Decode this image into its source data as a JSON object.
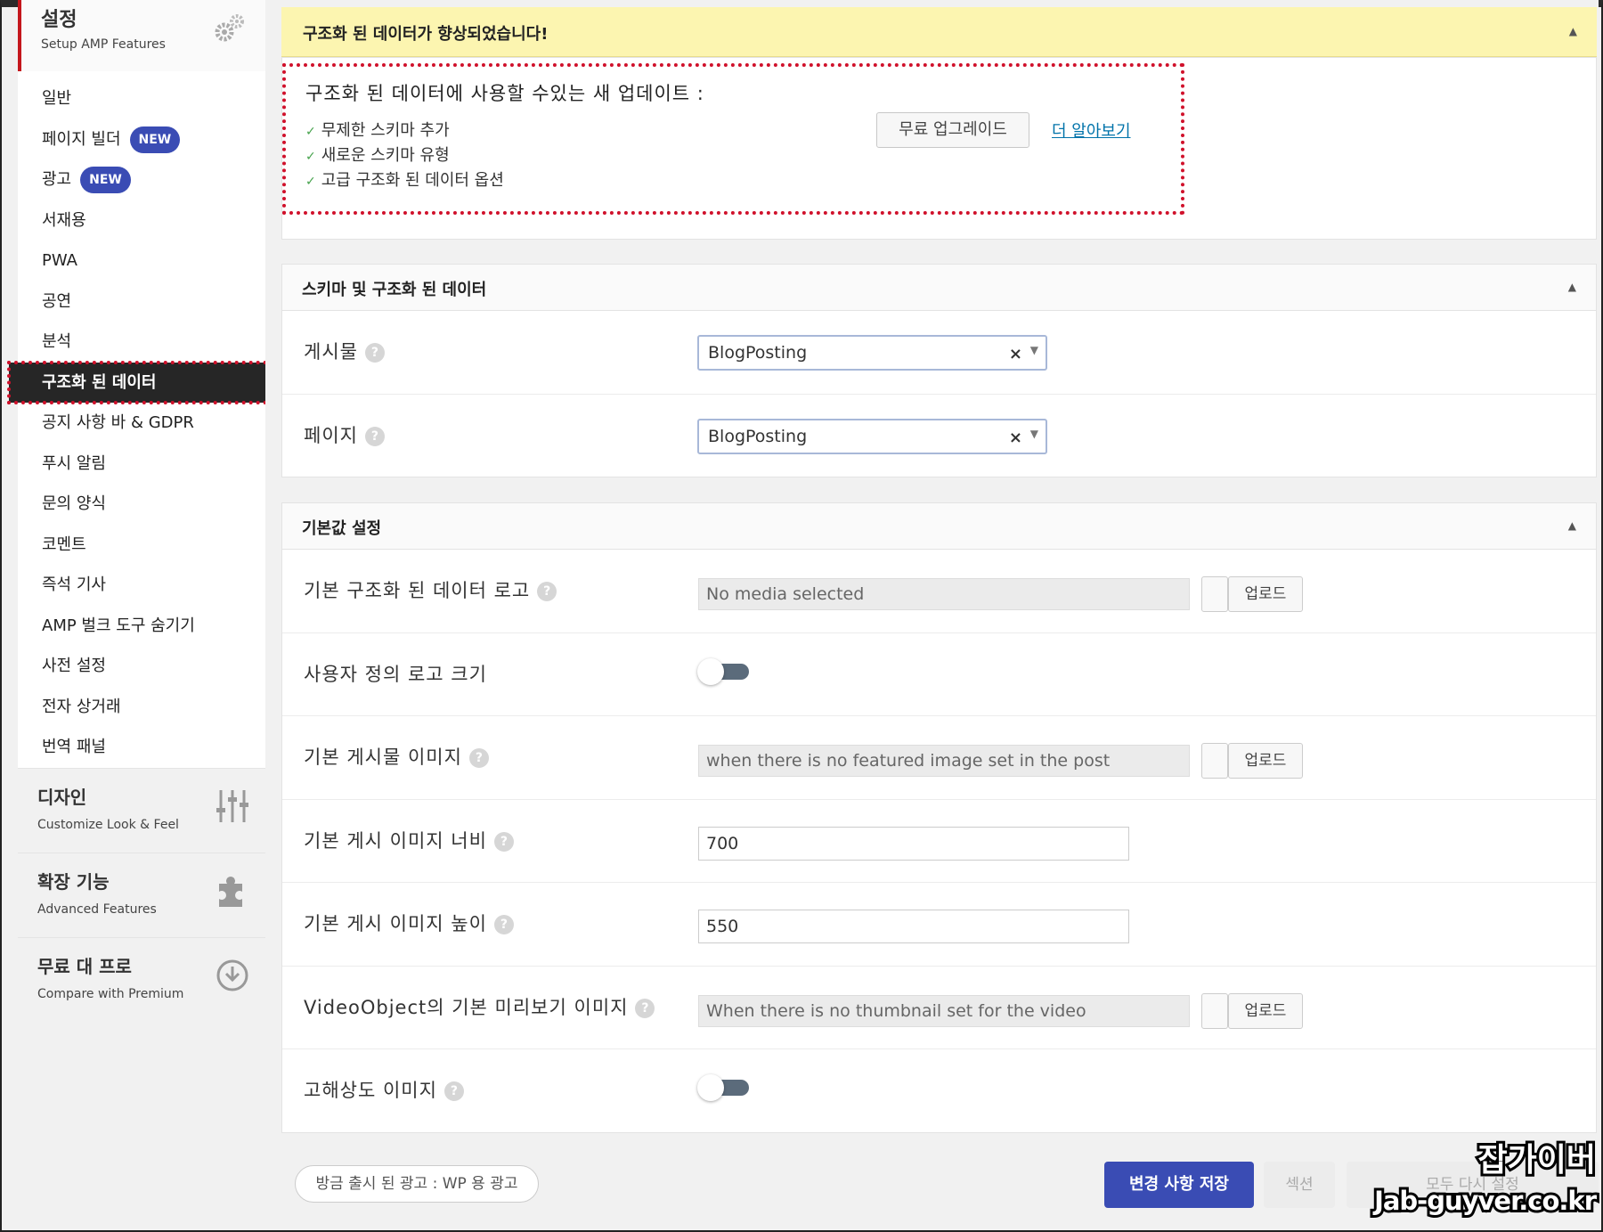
{
  "sidebar": {
    "header": {
      "title": "설정",
      "subtitle": "Setup AMP Features",
      "icon": "gears-icon"
    },
    "items": [
      {
        "label": "일반",
        "badge": ""
      },
      {
        "label": "페이지 빌더",
        "badge": "NEW"
      },
      {
        "label": "광고",
        "badge": "NEW"
      },
      {
        "label": "서재용",
        "badge": ""
      },
      {
        "label": "PWA",
        "badge": ""
      },
      {
        "label": "공연",
        "badge": ""
      },
      {
        "label": "분석",
        "badge": ""
      },
      {
        "label": "구조화 된 데이터",
        "badge": "",
        "active": true
      },
      {
        "label": "공지 사항 바 & GDPR",
        "badge": ""
      },
      {
        "label": "푸시 알림",
        "badge": ""
      },
      {
        "label": "문의 양식",
        "badge": ""
      },
      {
        "label": "코멘트",
        "badge": ""
      },
      {
        "label": "즉석 기사",
        "badge": ""
      },
      {
        "label": "AMP 벌크 도구 숨기기",
        "badge": ""
      },
      {
        "label": "사전 설정",
        "badge": ""
      },
      {
        "label": "전자 상거래",
        "badge": ""
      },
      {
        "label": "번역 패널",
        "badge": ""
      }
    ],
    "groups": [
      {
        "title": "디자인",
        "subtitle": "Customize Look & Feel",
        "icon": "sliders-icon"
      },
      {
        "title": "확장 기능",
        "subtitle": "Advanced Features",
        "icon": "puzzle-icon"
      },
      {
        "title": "무료 대 프로",
        "subtitle": "Compare with Premium",
        "icon": "download-circle-icon"
      }
    ]
  },
  "notice": {
    "text": "구조화 된 데이터가 향상되었습니다!"
  },
  "upgrade": {
    "heading": "구조화 된 데이터에 사용할 수있는 새 업데이트 :",
    "features": [
      "무제한 스키마 추가",
      "새로운 스키마 유형",
      "고급 구조화 된 데이터 옵션"
    ],
    "check_glyph": "✓",
    "button": "무료 업그레이드",
    "link": "더 알아보기"
  },
  "schema_section": {
    "title": "스키마 및 구조화 된 데이터",
    "rows": [
      {
        "label": "게시물",
        "value": "BlogPosting"
      },
      {
        "label": "페이지",
        "value": "BlogPosting"
      }
    ]
  },
  "defaults_section": {
    "title": "기본값 설정",
    "logo": {
      "label": "기본 구조화 된 데이터 로고",
      "placeholder": "No media selected",
      "button": "업로드"
    },
    "custom_logo_size": {
      "label": "사용자 정의 로고 크기",
      "enabled": false
    },
    "post_image": {
      "label": "기본 게시물 이미지",
      "placeholder": "when there is no featured image set in the post",
      "button": "업로드"
    },
    "image_width": {
      "label": "기본 게시 이미지 너비",
      "value": "700"
    },
    "image_height": {
      "label": "기본 게시 이미지 높이",
      "value": "550"
    },
    "video_thumb": {
      "label": "VideoObject의 기본 미리보기 이미지",
      "placeholder": "When there is no thumbnail set for the video",
      "button": "업로드"
    },
    "hires_image": {
      "label": "고해상도 이미지",
      "enabled": false
    }
  },
  "footer": {
    "ad_label": "방금 출시 된 광고 : WP 용 광고",
    "save": "변경 사항 저장",
    "section": "섹션",
    "reset": "모두 다시 설정"
  },
  "watermark": {
    "line1": "잡가이버",
    "line2": "Jab-guyver.co.kr"
  },
  "colors": {
    "accent": "#3a4cb4",
    "highlight": "#d0112b",
    "notice_bg": "#fcf5b0",
    "active_bg": "#262626"
  }
}
